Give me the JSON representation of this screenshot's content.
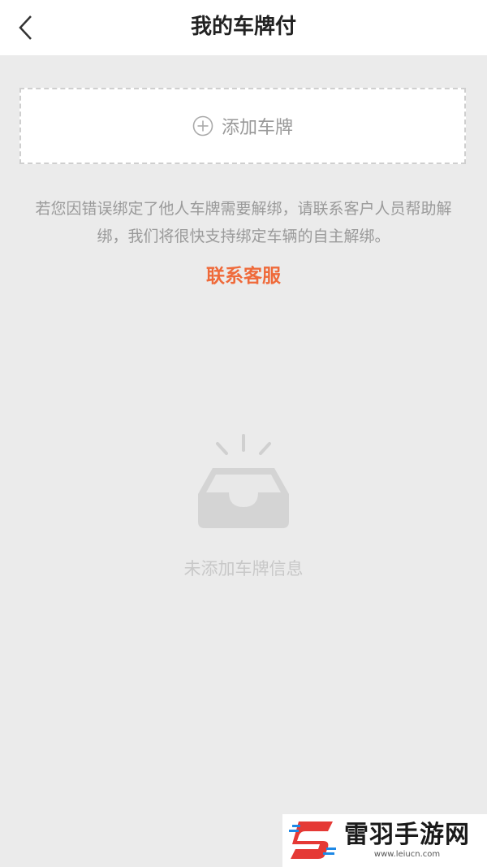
{
  "header": {
    "title": "我的车牌付",
    "back_icon": "chevron-left-icon"
  },
  "add_plate": {
    "label": "添加车牌",
    "icon": "plus-circle-icon"
  },
  "notice": {
    "text": "若您因错误绑定了他人车牌需要解绑，请联系客户人员帮助解绑，我们将很快支持绑定车辆的自主解绑。"
  },
  "contact": {
    "label": "联系客服",
    "color": "#ef6a3a"
  },
  "empty_state": {
    "icon": "empty-inbox-icon",
    "text": "未添加车牌信息"
  },
  "watermark": {
    "name": "雷羽手游网",
    "url": "www.leiucn.com"
  },
  "colors": {
    "background": "#ebebeb",
    "accent": "#ef6a3a"
  }
}
